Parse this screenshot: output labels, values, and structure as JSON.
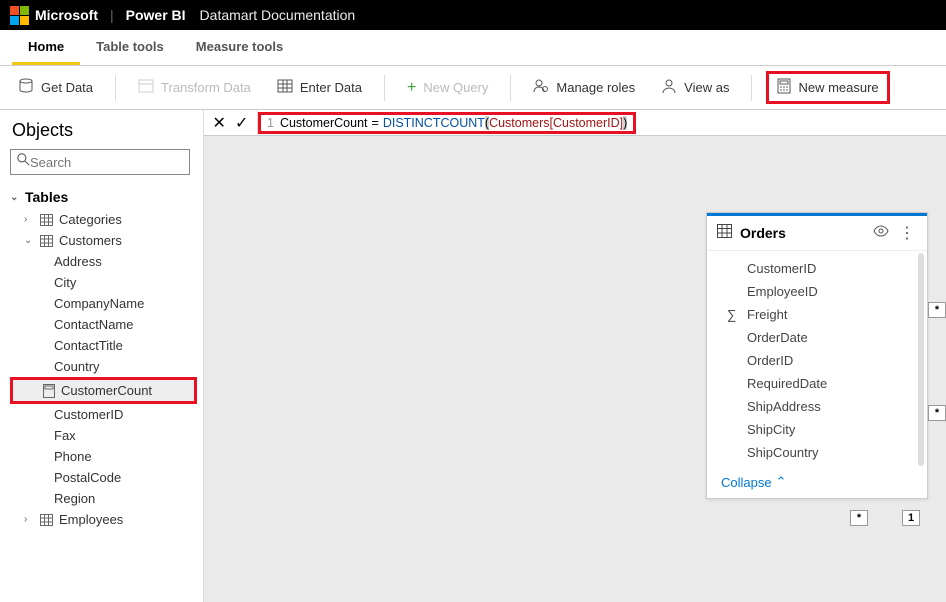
{
  "header": {
    "brand": "Microsoft",
    "app": "Power BI",
    "doc": "Datamart Documentation"
  },
  "ribbon": {
    "tabs": [
      "Home",
      "Table tools",
      "Measure tools"
    ],
    "active_index": 0
  },
  "toolbar": {
    "get_data": "Get Data",
    "transform_data": "Transform Data",
    "enter_data": "Enter Data",
    "new_query": "New Query",
    "manage_roles": "Manage roles",
    "view_as": "View as",
    "new_measure": "New measure"
  },
  "sidebar": {
    "title": "Objects",
    "search_placeholder": "Search",
    "tables_label": "Tables",
    "tables": [
      {
        "name": "Categories",
        "expanded": false
      },
      {
        "name": "Customers",
        "expanded": true,
        "columns": [
          "Address",
          "City",
          "CompanyName",
          "ContactName",
          "ContactTitle",
          "Country",
          "CustomerCount",
          "CustomerID",
          "Fax",
          "Phone",
          "PostalCode",
          "Region"
        ],
        "selected_column": "CustomerCount",
        "measure_columns": [
          "CustomerCount"
        ]
      },
      {
        "name": "Employees",
        "expanded": false
      }
    ]
  },
  "formula": {
    "line_no": "1",
    "measure_name": "CustomerCount",
    "equals": " = ",
    "function": "DISTINCTCOUNT",
    "open_paren": "(",
    "reference": "Customers[CustomerID]",
    "close_paren": ")"
  },
  "orders_card": {
    "title": "Orders",
    "fields": [
      {
        "name": "CustomerID",
        "sigma": false
      },
      {
        "name": "EmployeeID",
        "sigma": false
      },
      {
        "name": "Freight",
        "sigma": true
      },
      {
        "name": "OrderDate",
        "sigma": false
      },
      {
        "name": "OrderID",
        "sigma": false
      },
      {
        "name": "RequiredDate",
        "sigma": false
      },
      {
        "name": "ShipAddress",
        "sigma": false
      },
      {
        "name": "ShipCity",
        "sigma": false
      },
      {
        "name": "ShipCountry",
        "sigma": false
      }
    ],
    "collapse_label": "Collapse"
  },
  "relations": {
    "star": "*",
    "one": "1"
  }
}
